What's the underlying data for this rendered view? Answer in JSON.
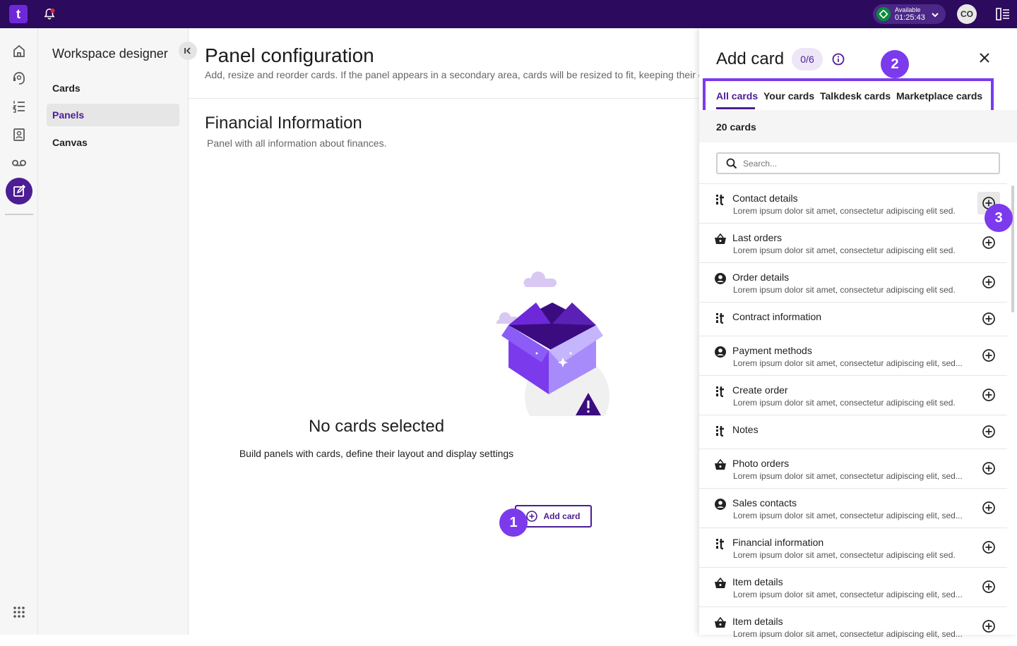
{
  "topbar": {
    "logo_letter": "t",
    "status": {
      "label": "Available",
      "timer": "01:25:43",
      "color": "#0b8a3e"
    },
    "avatar_initials": "CO",
    "icons": [
      "bell-icon",
      "chevron-down-icon",
      "side-panel-icon"
    ]
  },
  "rail": {
    "items": [
      "home-icon",
      "agent-icon",
      "list-icon",
      "contacts-icon",
      "voicemail-icon",
      "workspace-designer-icon"
    ],
    "bottom": "apps-grid-icon"
  },
  "sidenav": {
    "title": "Workspace designer",
    "items": [
      {
        "label": "Cards",
        "selected": false
      },
      {
        "label": "Panels",
        "selected": true
      },
      {
        "label": "Canvas",
        "selected": false
      }
    ]
  },
  "main": {
    "title": "Panel configuration",
    "description": "Add, resize and reorder cards. If the panel appears in a secondary area, cards will be resized to fit, keeping their de",
    "panel_title": "Financial Information",
    "panel_description": "Panel with all information about finances.",
    "empty_title": "No cards selected",
    "empty_subtitle": "Build panels with cards, define their layout and display settings",
    "add_button": "Add card"
  },
  "drawer": {
    "title": "Add card",
    "count": "0/6",
    "tabs": [
      {
        "label": "All cards",
        "selected": true
      },
      {
        "label": "Your cards",
        "selected": false
      },
      {
        "label": "Talkdesk cards",
        "selected": false
      },
      {
        "label": "Marketplace cards",
        "selected": false
      }
    ],
    "cards_count": "20 cards",
    "search_placeholder": "Search...",
    "cards": [
      {
        "title": "Contact details",
        "desc": "Lorem ipsum dolor sit amet, consectetur adipiscing elit sed.",
        "icon": "talkdesk"
      },
      {
        "title": "Last orders",
        "desc": "Lorem ipsum dolor sit amet, consectetur adipiscing elit sed.",
        "icon": "basket"
      },
      {
        "title": "Order details",
        "desc": "Lorem ipsum dolor sit amet, consectetur adipiscing elit sed.",
        "icon": "person"
      },
      {
        "title": "Contract information",
        "desc": "",
        "icon": "talkdesk"
      },
      {
        "title": "Payment methods",
        "desc": "Lorem ipsum dolor sit amet, consectetur adipiscing elit, sed...",
        "icon": "person"
      },
      {
        "title": "Create order",
        "desc": "Lorem ipsum dolor sit amet, consectetur adipiscing elit sed.",
        "icon": "talkdesk"
      },
      {
        "title": "Notes",
        "desc": "",
        "icon": "talkdesk"
      },
      {
        "title": "Photo orders",
        "desc": "Lorem ipsum dolor sit amet, consectetur adipiscing elit, sed...",
        "icon": "basket"
      },
      {
        "title": "Sales contacts",
        "desc": "Lorem ipsum dolor sit amet, consectetur adipiscing elit, sed...",
        "icon": "person"
      },
      {
        "title": "Financial information",
        "desc": "Lorem ipsum dolor sit amet, consectetur adipiscing elit sed.",
        "icon": "talkdesk"
      },
      {
        "title": "Item details",
        "desc": "Lorem ipsum dolor sit amet, consectetur adipiscing elit, sed...",
        "icon": "basket"
      },
      {
        "title": "Item details",
        "desc": "Lorem ipsum dolor sit amet, consectetur adipiscing elit, sed...",
        "icon": "basket"
      }
    ]
  },
  "annotations": [
    "1",
    "2",
    "3"
  ],
  "colors": {
    "brand_dark": "#2c0a5e",
    "accent": "#4c1d95",
    "annotation": "#7c3aed"
  }
}
